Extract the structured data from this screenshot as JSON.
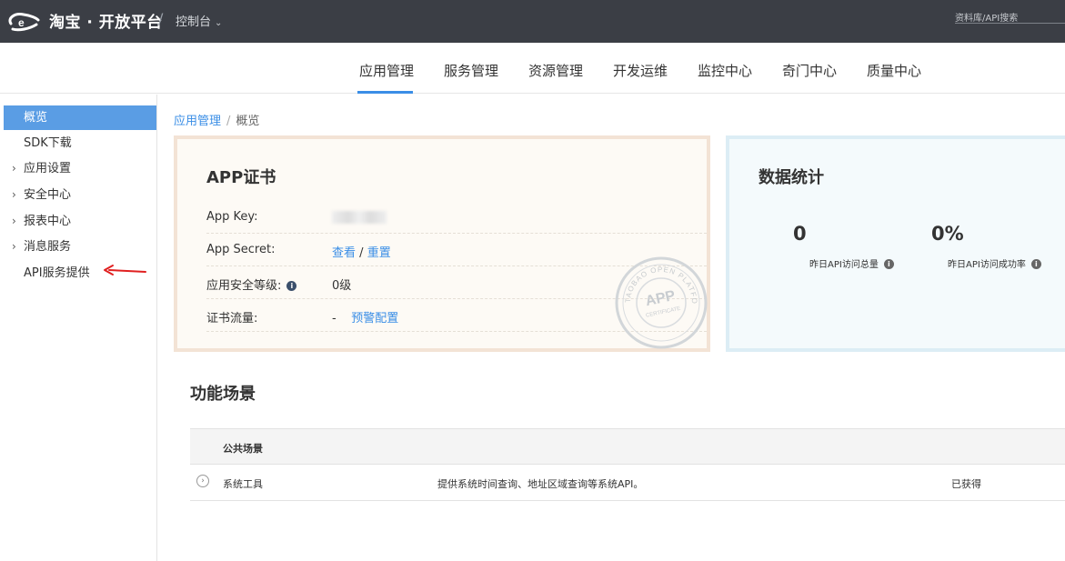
{
  "topbar": {
    "brand": "淘宝 · 开放平台",
    "separator": "/",
    "console": "控制台",
    "search_placeholder": "资料库/API搜索"
  },
  "mainnav": {
    "items": [
      "应用管理",
      "服务管理",
      "资源管理",
      "开发运维",
      "监控中心",
      "奇门中心",
      "质量中心"
    ],
    "active_index": 0
  },
  "sidebar": {
    "items": [
      {
        "label": "概览",
        "expandable": false,
        "active": true
      },
      {
        "label": "SDK下载",
        "expandable": false,
        "active": false
      },
      {
        "label": "应用设置",
        "expandable": true,
        "active": false
      },
      {
        "label": "安全中心",
        "expandable": true,
        "active": false
      },
      {
        "label": "报表中心",
        "expandable": true,
        "active": false
      },
      {
        "label": "消息服务",
        "expandable": true,
        "active": false
      },
      {
        "label": "API服务提供",
        "expandable": false,
        "active": false
      }
    ]
  },
  "breadcrumb": {
    "parent": "应用管理",
    "separator": "/",
    "current": "概览"
  },
  "cert": {
    "title": "APP证书",
    "app_key_label": "App Key:",
    "app_secret_label": "App Secret:",
    "app_secret_view": "查看",
    "app_secret_sep": "/",
    "app_secret_reset": "重置",
    "security_level_label": "应用安全等级:",
    "security_level_value": "0级",
    "traffic_label": "证书流量:",
    "traffic_value": "-",
    "traffic_link": "预警配置",
    "stamp_text_top": "TAOBAO OPEN PLATFORM",
    "stamp_text_center": "APP",
    "stamp_text_bottom": "CERTIFICATE"
  },
  "stats": {
    "title": "数据统计",
    "items": [
      {
        "value": "0",
        "label": "昨日API访问总量"
      },
      {
        "value": "0%",
        "label": "昨日API访问成功率"
      }
    ]
  },
  "features": {
    "title": "功能场景",
    "header": "公共场景",
    "rows": [
      {
        "name": "系统工具",
        "desc": "提供系统时间查询、地址区域查询等系统API。",
        "status": "已获得"
      }
    ]
  },
  "colors": {
    "topbar": "#3b3e45",
    "accent": "#3a8ee6",
    "sidebar_active": "#5a9de4",
    "annotation_arrow": "#e02020"
  }
}
